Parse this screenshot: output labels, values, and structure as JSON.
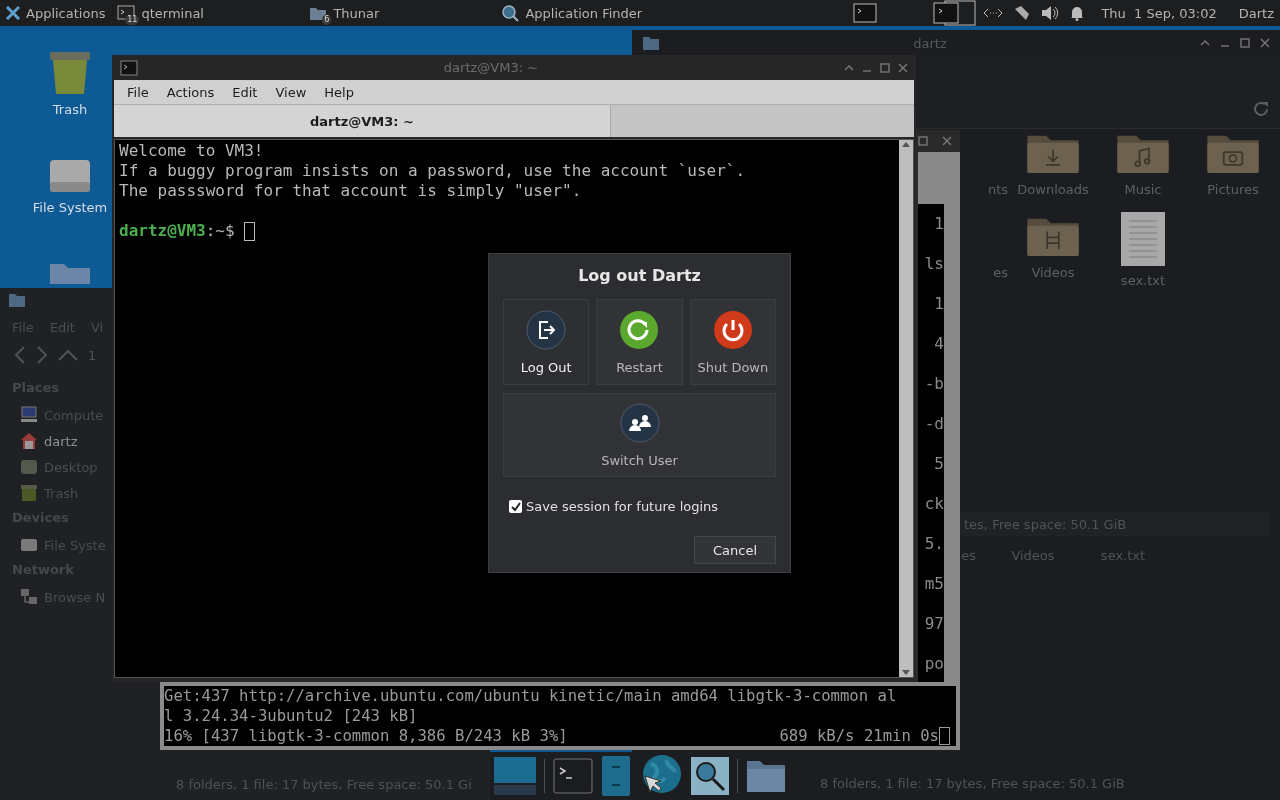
{
  "top_panel": {
    "applications_menu": "Applications",
    "tasks": [
      {
        "label": "qterminal",
        "badge": "11",
        "kind": "terminal"
      },
      {
        "label": "Thunar",
        "badge": "6",
        "kind": "folder"
      },
      {
        "label": "Application Finder",
        "kind": "search"
      }
    ],
    "clock": "Thu  1 Sep, 03:02",
    "user": "Dartz"
  },
  "desktop_icons": [
    {
      "label": "Trash",
      "kind": "trash"
    },
    {
      "label": "File System",
      "kind": "drive"
    },
    {
      "kind": "folder"
    }
  ],
  "file_manager_back": {
    "title": "dartz",
    "items": [
      {
        "label": "nts"
      },
      {
        "label": "Downloads",
        "kind": "download"
      },
      {
        "label": "Music",
        "kind": "music"
      },
      {
        "label": "Pictures",
        "kind": "camera"
      },
      {
        "label": "es"
      },
      {
        "label": "Videos",
        "kind": "video"
      },
      {
        "label": "sex.txt",
        "kind": "text"
      }
    ],
    "status": "tes, Free space: 50.1 GiB",
    "lower_items": [
      "es",
      "Videos",
      "sex.txt"
    ],
    "lower_status": "8 folders, 1 file: 17 bytes, Free space: 50.1 GiB"
  },
  "file_manager_left": {
    "menu": [
      "File",
      "Edit",
      "Vi"
    ],
    "path_fragment": "1",
    "sidebar": [
      {
        "heading": "Places",
        "items": [
          {
            "label": "Compute",
            "kind": "computer",
            "selected": false
          },
          {
            "label": "dartz",
            "kind": "home",
            "selected": true
          },
          {
            "label": "Desktop",
            "kind": "desktop",
            "selected": false
          },
          {
            "label": "Trash",
            "kind": "trash",
            "selected": false
          }
        ]
      },
      {
        "heading": "Devices",
        "items": [
          {
            "label": "File Syste",
            "kind": "drive",
            "selected": false
          }
        ]
      },
      {
        "heading": "Network",
        "items": [
          {
            "label": "Browse N",
            "kind": "network",
            "selected": false
          }
        ]
      }
    ],
    "status": "8 folders, 1 file: 17 bytes, Free space: 50.1 Gi"
  },
  "terminal_back": {
    "column_fragments": [
      "1",
      "ls",
      "1",
      "4",
      "-b",
      "-d",
      "5",
      "ck",
      "5.",
      "m5",
      "97",
      "po"
    ],
    "lines": [
      "Get:437 http://archive.ubuntu.com/ubuntu kinetic/main amd64 libgtk-3-common al",
      "l 3.24.34-3ubuntu2 [243 kB]"
    ],
    "progress": "16% [437 libgtk-3-common 8,386 B/243 kB 3%]",
    "speed": "689 kB/s 21min 0s"
  },
  "terminal_front": {
    "title": "dartz@VM3: ~",
    "menu": [
      "File",
      "Actions",
      "Edit",
      "View",
      "Help"
    ],
    "tab": "dartz@VM3: ~",
    "lines": [
      "Welcome to VM3!",
      "If a buggy program insists on a password, use the account `user`.",
      "The passsword for that account is simply \"user\"."
    ],
    "prompt_user": "dartz@VM3",
    "prompt_path": ":~$"
  },
  "logout_dialog": {
    "title": "Log out Dartz",
    "actions": [
      {
        "label": "Log Out",
        "kind": "logout",
        "selected": true
      },
      {
        "label": "Restart",
        "kind": "restart",
        "selected": false
      },
      {
        "label": "Shut Down",
        "kind": "shutdown",
        "selected": false
      },
      {
        "label": "Switch User",
        "kind": "switch",
        "selected": false
      }
    ],
    "save_session": {
      "label": "Save session for future logins",
      "checked": true
    },
    "cancel": "Cancel"
  },
  "dock": [
    {
      "kind": "desktop"
    },
    {
      "kind": "separator"
    },
    {
      "kind": "terminal"
    },
    {
      "kind": "cabinet"
    },
    {
      "kind": "browser"
    },
    {
      "kind": "search"
    },
    {
      "kind": "separator"
    },
    {
      "kind": "folder"
    }
  ]
}
